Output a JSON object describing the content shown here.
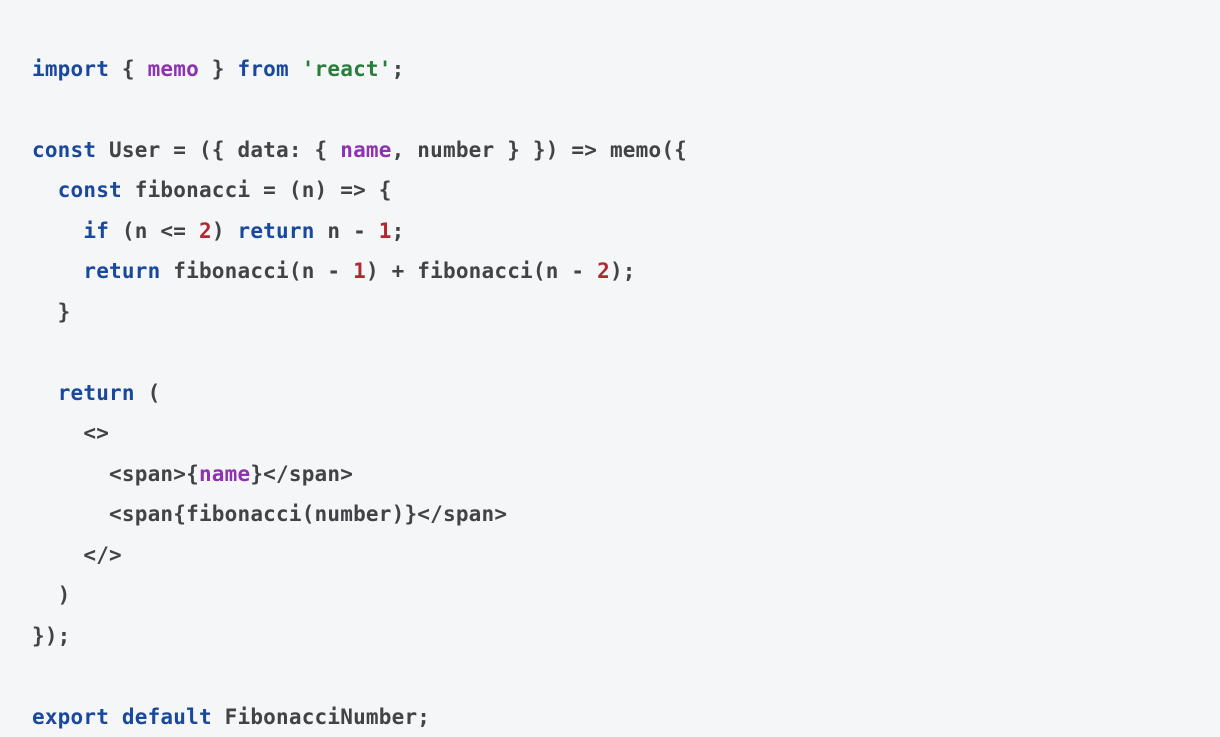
{
  "syntax": {
    "keywords": [
      "import",
      "from",
      "const",
      "if",
      "return",
      "export",
      "default"
    ],
    "purple_identifiers": [
      "memo",
      "name"
    ],
    "string_literal": "'react'",
    "numbers": [
      "2",
      "1"
    ]
  },
  "code": {
    "l1": {
      "a": "import",
      "b": " { ",
      "c": "memo",
      "d": " } ",
      "e": "from",
      "f": " ",
      "g": "'react'",
      "h": ";"
    },
    "l2": "",
    "l3": {
      "a": "const",
      "b": " User = ({ data: { ",
      "c": "name",
      "d": ", number } }) => memo({"
    },
    "l4": {
      "a": "  ",
      "b": "const",
      "c": " fibonacci = (n) => {"
    },
    "l5": {
      "a": "    ",
      "b": "if",
      "c": " (n <= ",
      "d": "2",
      "e": ") ",
      "f": "return",
      "g": " n - ",
      "h": "1",
      "i": ";"
    },
    "l6": {
      "a": "    ",
      "b": "return",
      "c": " fibonacci(n - ",
      "d": "1",
      "e": ") + fibonacci(n - ",
      "f": "2",
      "g": ");"
    },
    "l7": "  }",
    "l8": "",
    "l9": {
      "a": "  ",
      "b": "return",
      "c": " ("
    },
    "l10": "    <>",
    "l11": {
      "a": "      <span>{",
      "b": "name",
      "c": "}</span>"
    },
    "l12": "      <span{fibonacci(number)}</span>",
    "l13": "    </>",
    "l14": "  )",
    "l15": "});",
    "l16": "",
    "l17": {
      "a": "export",
      "b": " ",
      "c": "default",
      "d": " FibonacciNumber;"
    }
  }
}
